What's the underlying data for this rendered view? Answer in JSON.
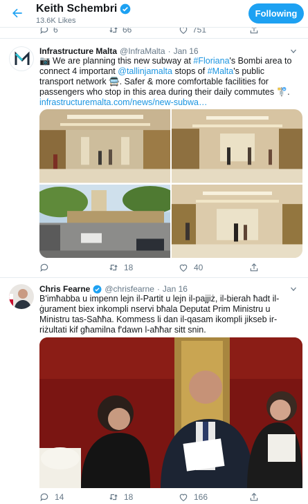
{
  "header": {
    "name": "Keith Schembri",
    "tweet_count": "13.6K Likes",
    "follow_label": "Following"
  },
  "prev_tweet": {
    "replies": "6",
    "retweets": "66",
    "likes": "751"
  },
  "tweets": [
    {
      "name": "Infrastructure Malta",
      "handle": "@InfraMalta",
      "sep": "·",
      "date": "Jan 16",
      "text_parts": [
        "📷 We are planning this new subway at ",
        "#Floriana",
        "'s Bombi area to connect 4 important ",
        "@tallinjamalta",
        " stops of ",
        "#Malta",
        "'s public transport network 🚍. Safer & more comfortable facilities for passengers who stop in this area during their daily commutes 🚏.",
        "infrastructuremalta.com/news/new-subwa…"
      ],
      "replies": "",
      "retweets": "18",
      "likes": "40"
    },
    {
      "name": "Chris Fearne",
      "handle": "@chrisfearne",
      "sep": "·",
      "date": "Jan 16",
      "text": "B'imħabba u impenn lejn il-Partit u lejn il-pajjiż, il-bierah ħadt il-ġurament biex inkompli nservi bħala Deputat Prim Ministru u Ministru tas-Saħħa. Kommess li dan il-qasam ikompli jikseb ir-riżultati kif għamilna f'dawn l-aħħar sitt snin.",
      "replies": "14",
      "retweets": "18",
      "likes": "166"
    }
  ],
  "colors": {
    "accent": "#1da1f2",
    "link": "#1b95e0",
    "secondary_text": "#657786",
    "divider": "#e6ecf0"
  },
  "icons": [
    "back-arrow-icon",
    "verified-icon",
    "reply-icon",
    "retweet-icon",
    "like-icon",
    "share-icon",
    "caret-down-icon",
    "camera-icon"
  ]
}
